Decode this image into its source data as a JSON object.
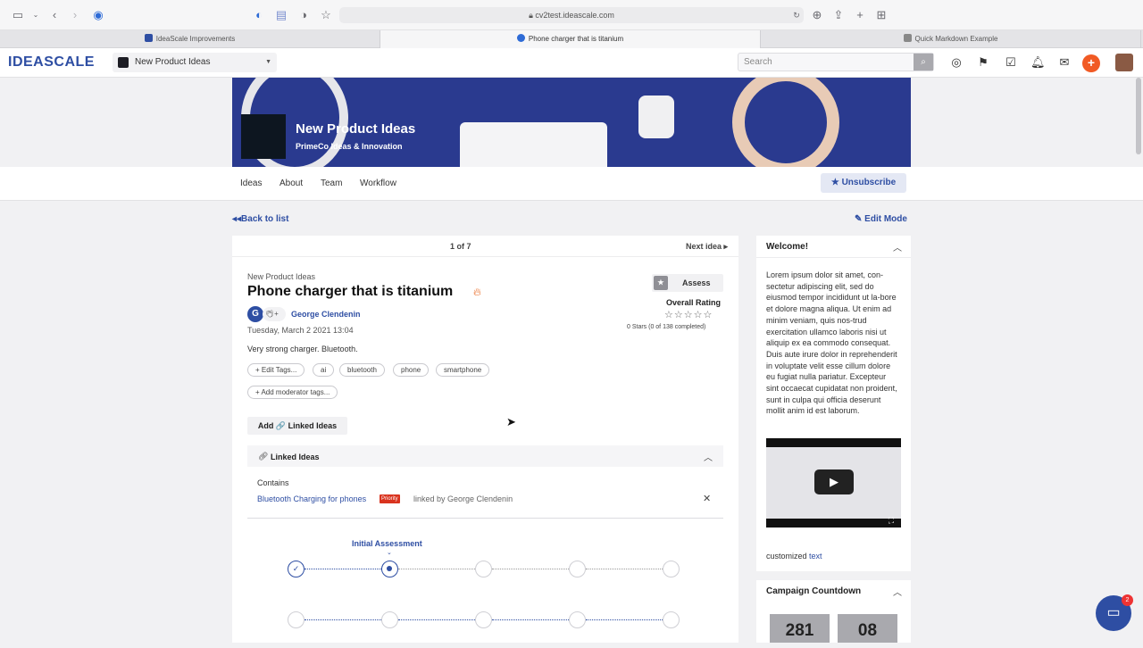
{
  "browser": {
    "url": "cv2test.ideascale.com",
    "tabs": [
      {
        "label": "IdeaScale Improvements",
        "active": false
      },
      {
        "label": "Phone charger that is titanium",
        "active": true
      },
      {
        "label": "Quick Markdown Example",
        "active": false
      }
    ]
  },
  "header": {
    "logo": "IDEASCALE",
    "community": "New Product Ideas",
    "search_placeholder": "Search",
    "add_label": "+"
  },
  "banner": {
    "title": "New Product Ideas",
    "subtitle": "PrimeCo Ideas & Innovation"
  },
  "subnav": {
    "items": [
      "Ideas",
      "About",
      "Team",
      "Workflow"
    ],
    "unsubscribe": "Unsubscribe"
  },
  "content": {
    "back": "Back to list",
    "edit_mode": "Edit Mode",
    "pager": "1 of 7",
    "next": "Next idea",
    "idea": {
      "community": "New Product Ideas",
      "title": "Phone charger that is titanium",
      "author_initial": "G",
      "author": "George Clendenin",
      "date": "Tuesday, March 2 2021 13:04",
      "description": "Very strong charger. Bluetooth.",
      "edit_tags": "+ Edit Tags...",
      "tags": [
        "ai",
        "bluetooth",
        "phone",
        "smartphone"
      ],
      "moderator_tags": "+ Add moderator tags...",
      "assess": "Assess",
      "overall_rating": "Overall Rating",
      "stars_text": "0 Stars (0 of 138 completed)",
      "add_linked": "Add 🔗 Linked Ideas"
    },
    "linked": {
      "title": "Linked Ideas",
      "contains": "Contains",
      "item": "Bluetooth Charging for phones",
      "badge": "Priority",
      "linked_by": "linked by George Clendenin"
    },
    "workflow": {
      "current_stage": "Initial Assessment"
    }
  },
  "sidebar": {
    "welcome_title": "Welcome!",
    "welcome_text": "Lorem ipsum dolor sit amet, con-sectetur adipiscing elit, sed do eiusmod tempor incididunt ut la-bore et dolore magna aliqua. Ut enim ad minim veniam, quis nos-trud exercitation ullamco laboris nisi ut aliquip ex ea commodo consequat. Duis aute irure dolor in reprehenderit in voluptate velit esse cillum dolore eu fugiat nulla pariatur. Excepteur sint occaecat cupidatat non proident, sunt in culpa qui officia deserunt mollit anim id est laborum.",
    "custom_prefix": "customized ",
    "custom_link": "text",
    "countdown_title": "Campaign Countdown",
    "countdown_days": "281",
    "countdown_hours": "08"
  },
  "chat": {
    "badge": "2"
  },
  "colors": {
    "brand": "#2e4ea3",
    "accent": "#f15a24",
    "priority": "#d9331e"
  }
}
